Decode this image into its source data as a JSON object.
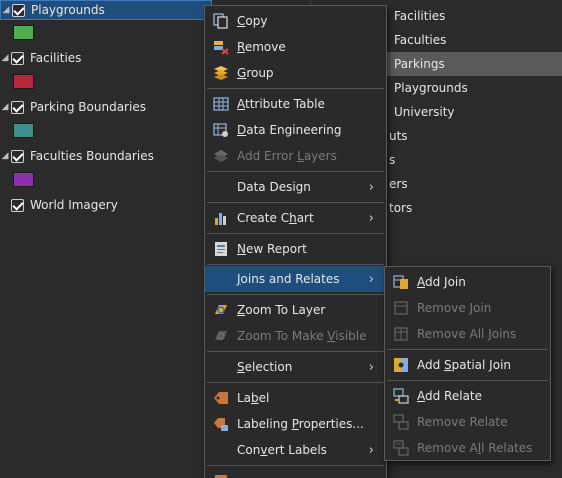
{
  "toc": {
    "layers": [
      {
        "name": "Playgrounds",
        "checked": true,
        "selected": true,
        "swatch": "#4caf50"
      },
      {
        "name": "Facilities",
        "checked": true,
        "selected": false,
        "swatch": "#b5293c"
      },
      {
        "name": "Parking Boundaries",
        "checked": true,
        "selected": false,
        "swatch": "#3f8f8f"
      },
      {
        "name": "Faculties Boundaries",
        "checked": true,
        "selected": false,
        "swatch": "#8a2fae"
      },
      {
        "name": "World Imagery",
        "checked": true,
        "selected": false,
        "swatch": null
      }
    ]
  },
  "right_list": {
    "items": [
      "Facilities",
      "Faculties",
      "Parkings",
      "Playgrounds",
      "University"
    ],
    "highlighted": "Parkings",
    "partial": [
      "uts",
      "s",
      "ers",
      "tors"
    ]
  },
  "context_menu": {
    "items": [
      {
        "pre": "",
        "u": "C",
        "post": "opy",
        "icon": "copy-icon",
        "enabled": true
      },
      {
        "pre": "",
        "u": "R",
        "post": "emove",
        "icon": "remove-icon",
        "enabled": true
      },
      {
        "pre": "",
        "u": "G",
        "post": "roup",
        "icon": "group-icon",
        "enabled": true
      },
      {
        "pre": "",
        "u": "A",
        "post": "ttribute Table",
        "icon": "attribute-table-icon",
        "enabled": true
      },
      {
        "pre": "",
        "u": "D",
        "post": "ata Engineering",
        "icon": "data-engineering-icon",
        "enabled": true
      },
      {
        "pre": "Add Error ",
        "u": "L",
        "post": "ayers",
        "icon": "error-layers-icon",
        "enabled": false
      },
      {
        "pre": "Data Design",
        "u": "",
        "post": "",
        "icon": "",
        "enabled": true,
        "submenu": true
      },
      {
        "pre": "Create C",
        "u": "h",
        "post": "art",
        "icon": "chart-icon",
        "enabled": true,
        "submenu": true
      },
      {
        "pre": "",
        "u": "N",
        "post": "ew Report",
        "icon": "report-icon",
        "enabled": true
      },
      {
        "pre": "",
        "u": "J",
        "post": "oins and Relates",
        "icon": "",
        "enabled": true,
        "submenu": true,
        "active": true
      },
      {
        "pre": "",
        "u": "Z",
        "post": "oom To Layer",
        "icon": "zoom-to-layer-icon",
        "enabled": true
      },
      {
        "pre": "Zoom To Make ",
        "u": "V",
        "post": "isible",
        "icon": "zoom-visible-icon",
        "enabled": false
      },
      {
        "pre": "",
        "u": "S",
        "post": "election",
        "icon": "",
        "enabled": true,
        "submenu": true
      },
      {
        "pre": "La",
        "u": "b",
        "post": "el",
        "icon": "label-icon",
        "enabled": true
      },
      {
        "pre": "Labeling ",
        "u": "P",
        "post": "roperties...",
        "icon": "labeling-properties-icon",
        "enabled": true
      },
      {
        "pre": "Con",
        "u": "v",
        "post": "ert Labels",
        "icon": "",
        "enabled": true,
        "submenu": true
      }
    ],
    "arrow": "›"
  },
  "submenu": {
    "items": [
      {
        "pre": "",
        "u": "A",
        "post": "dd Join",
        "enabled": true
      },
      {
        "pre": "Remove Join",
        "u": "",
        "post": "",
        "enabled": false
      },
      {
        "pre": "Remove All ",
        "u": "J",
        "post": "oins",
        "enabled": false
      },
      {
        "pre": "Add ",
        "u": "S",
        "post": "patial Join",
        "enabled": true
      },
      {
        "pre": "",
        "u": "A",
        "post": "dd Relate",
        "enabled": true
      },
      {
        "pre": "Remove Relate",
        "u": "",
        "post": "",
        "enabled": false
      },
      {
        "pre": "Remove A",
        "u": "l",
        "post": "l Relates",
        "enabled": false
      }
    ]
  },
  "colors": {
    "selection": "#1f4e7d",
    "highlight_row": "#5a5a5a",
    "menu_bg": "#2a2a2a",
    "disabled_text": "#7a7a7a"
  }
}
